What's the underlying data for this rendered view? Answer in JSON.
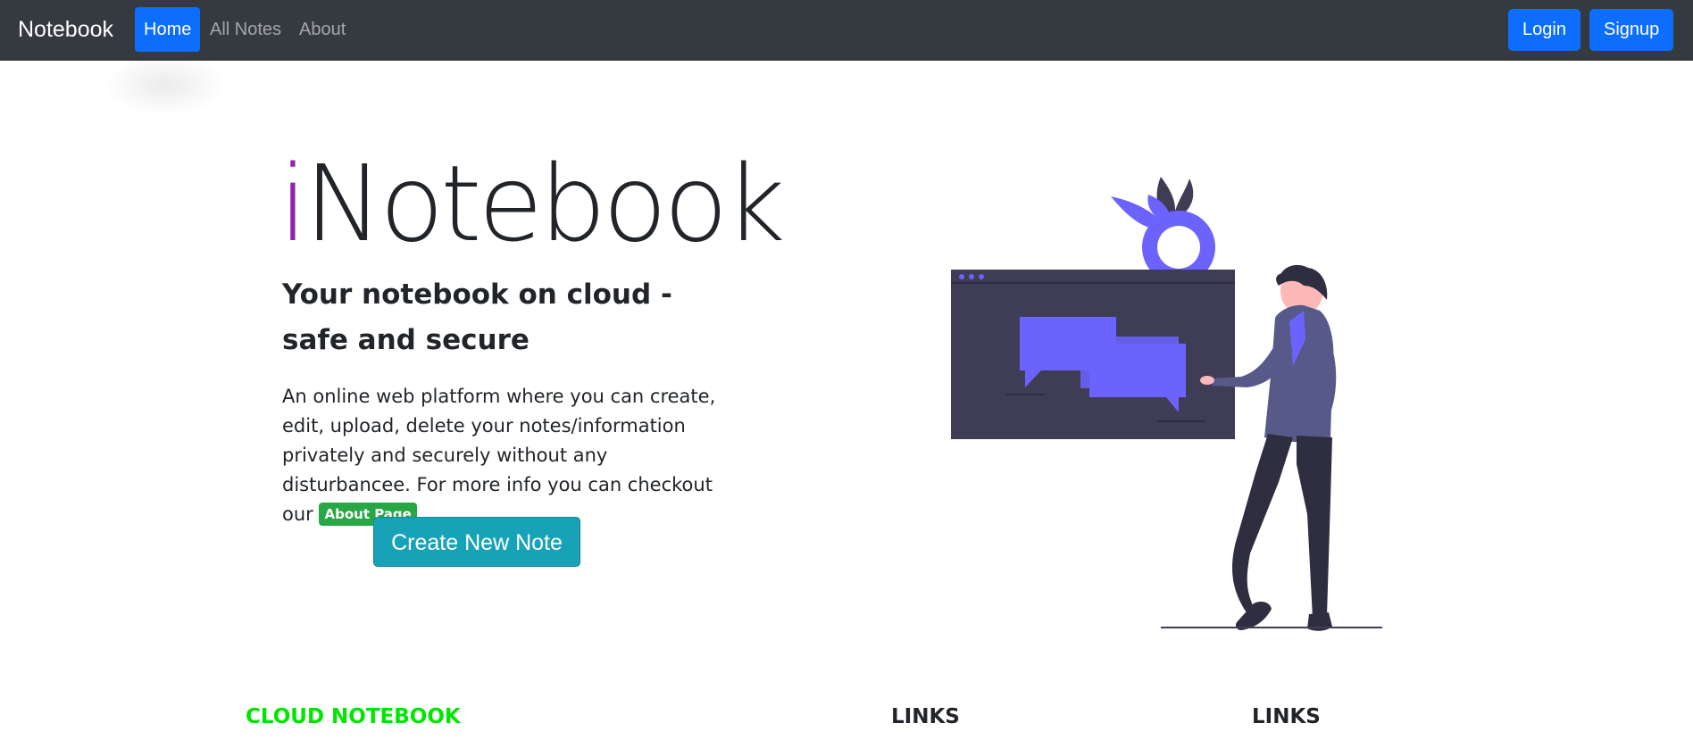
{
  "navbar": {
    "brand": "Notebook",
    "links": [
      "Home",
      "All Notes",
      "About"
    ],
    "login_label": "Login",
    "signup_label": "Signup"
  },
  "hero": {
    "title_i": "i",
    "title_rest": "Notebook",
    "subtitle": "Your notebook on cloud - safe and secure",
    "description": "An online web platform where you can create, edit, upload, delete your notes/information privately and securely without any disturbancee. For more info you can checkout our",
    "about_badge": "About Page",
    "create_button": "Create New Note"
  },
  "footer": {
    "col1_heading": "CLOUD NOTEBOOK",
    "col2_heading": "LINKS",
    "col3_heading": "LINKS"
  },
  "colors": {
    "navbar_bg": "#343a40",
    "primary": "#0d6efd",
    "info": "#17a2b8",
    "success": "#28a745",
    "accent_purple": "#6c63ff",
    "footer_green": "#00e600"
  }
}
